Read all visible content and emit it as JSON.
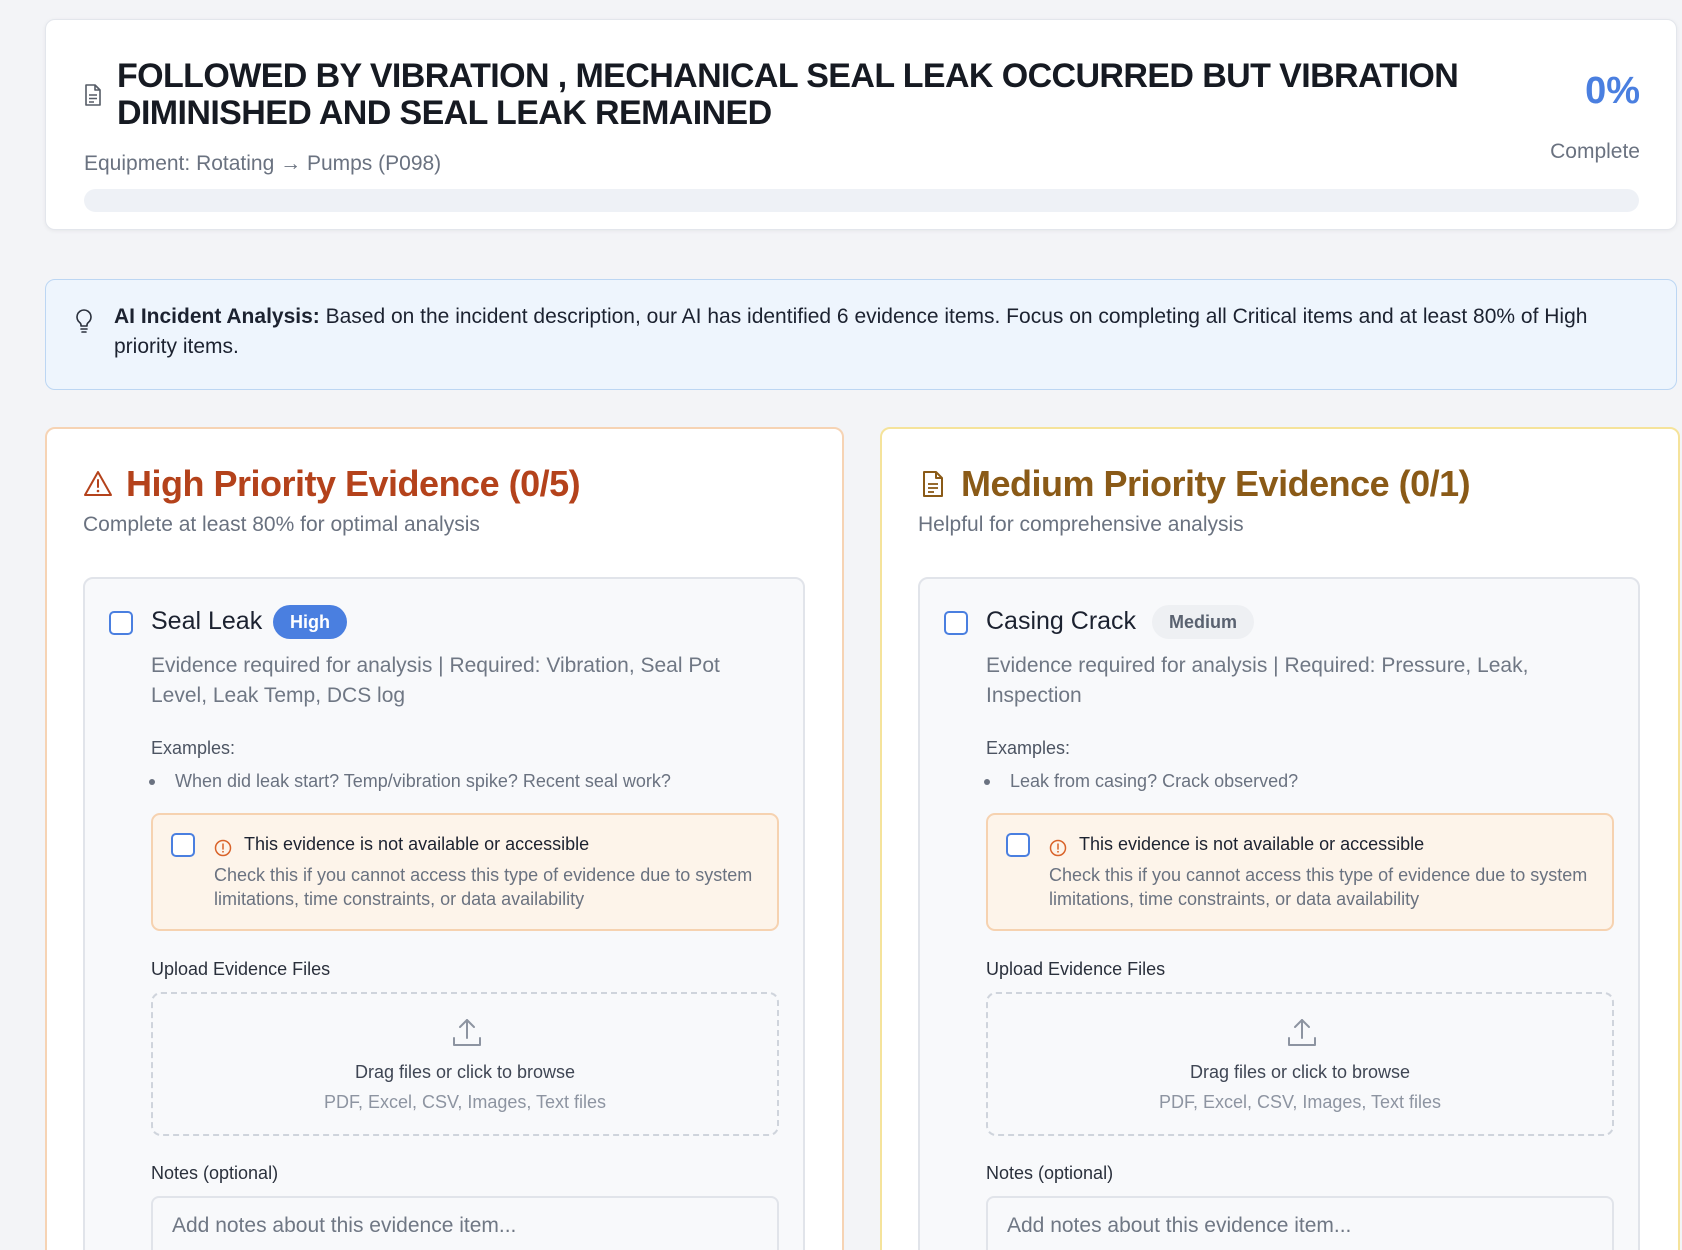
{
  "header": {
    "title": "FOLLOWED BY VIBRATION , MECHANICAL SEAL LEAK OCCURRED BUT VIBRATION DIMINISHED AND SEAL LEAK REMAINED",
    "equipment": "Equipment: Rotating → Pumps (P098)",
    "percent": "0%",
    "percent_label": "Complete",
    "progress": 0
  },
  "ai_banner": {
    "label": "AI Incident Analysis:",
    "text": " Based on the incident description, our AI has identified 6 evidence items. Focus on completing all Critical items and at least 80% of High priority items."
  },
  "sections": [
    {
      "title": "High Priority Evidence (0/5)",
      "subtitle": "Complete at least 80% for optimal analysis",
      "item": {
        "title": "Seal Leak",
        "badge": "High",
        "description": "Evidence required for analysis | Required: Vibration, Seal Pot Level, Leak Temp, DCS log",
        "examples_label": "Examples:",
        "example": "When did leak start? Temp/vibration spike? Recent seal work?",
        "na_title": "This evidence is not available or accessible",
        "na_desc": "Check this if you cannot access this type of evidence due to system limitations, time constraints, or data availability",
        "upload_label": "Upload Evidence Files",
        "drop_text": "Drag files or click to browse",
        "drop_types": "PDF, Excel, CSV, Images, Text files",
        "notes_label": "Notes (optional)",
        "notes_placeholder": "Add notes about this evidence item..."
      }
    },
    {
      "title": "Medium Priority Evidence (0/1)",
      "subtitle": "Helpful for comprehensive analysis",
      "item": {
        "title": "Casing Crack",
        "badge": "Medium",
        "description": "Evidence required for analysis | Required: Pressure, Leak, Inspection",
        "examples_label": "Examples:",
        "example": "Leak from casing? Crack observed?",
        "na_title": "This evidence is not available or accessible",
        "na_desc": "Check this if you cannot access this type of evidence due to system limitations, time constraints, or data availability",
        "upload_label": "Upload Evidence Files",
        "drop_text": "Drag files or click to browse",
        "drop_types": "PDF, Excel, CSV, Images, Text files",
        "notes_label": "Notes (optional)",
        "notes_placeholder": "Add notes about this evidence item..."
      }
    }
  ],
  "icons": {
    "header": "document-icon",
    "banner": "lightbulb-icon",
    "high": "warning-triangle-icon",
    "medium": "document-icon",
    "na": "alert-circle-icon",
    "upload": "upload-icon"
  },
  "colors": {
    "accent": "#4a7fe0",
    "high_title": "#b4421b",
    "medium_title": "#8a5a17",
    "high_border": "#f6d3b4",
    "medium_border": "#f5e39b"
  }
}
